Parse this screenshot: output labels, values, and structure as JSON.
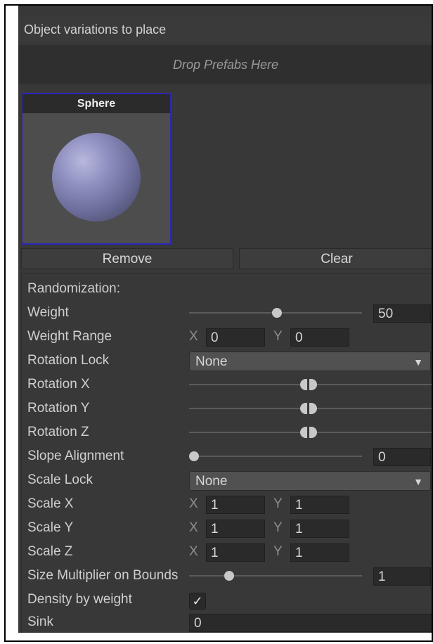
{
  "header": {
    "title": "Object variations to place"
  },
  "dropzone": {
    "text": "Drop Prefabs Here"
  },
  "prefab": {
    "name": "Sphere"
  },
  "buttons": {
    "remove": "Remove",
    "clear": "Clear"
  },
  "randomization": {
    "title": "Randomization:",
    "weight": {
      "label": "Weight",
      "value": "50"
    },
    "weight_range": {
      "label": "Weight Range",
      "x_label": "X",
      "x": "0",
      "y_label": "Y",
      "y": "0"
    },
    "rotation_lock": {
      "label": "Rotation Lock",
      "value": "None"
    },
    "rotation_x": {
      "label": "Rotation X"
    },
    "rotation_y": {
      "label": "Rotation Y"
    },
    "rotation_z": {
      "label": "Rotation Z"
    },
    "slope_alignment": {
      "label": "Slope Alignment",
      "value": "0"
    },
    "scale_lock": {
      "label": "Scale Lock",
      "value": "None"
    },
    "scale_x": {
      "label": "Scale X",
      "x_label": "X",
      "x": "1",
      "y_label": "Y",
      "y": "1"
    },
    "scale_y": {
      "label": "Scale Y",
      "x_label": "X",
      "x": "1",
      "y_label": "Y",
      "y": "1"
    },
    "scale_z": {
      "label": "Scale Z",
      "x_label": "X",
      "x": "1",
      "y_label": "Y",
      "y": "1"
    },
    "size_multiplier": {
      "label": "Size Multiplier on Bounds",
      "value": "1"
    },
    "density_by_weight": {
      "label": "Density by weight",
      "checked": true,
      "check_glyph": "✓"
    },
    "sink": {
      "label": "Sink",
      "value": "0"
    }
  }
}
